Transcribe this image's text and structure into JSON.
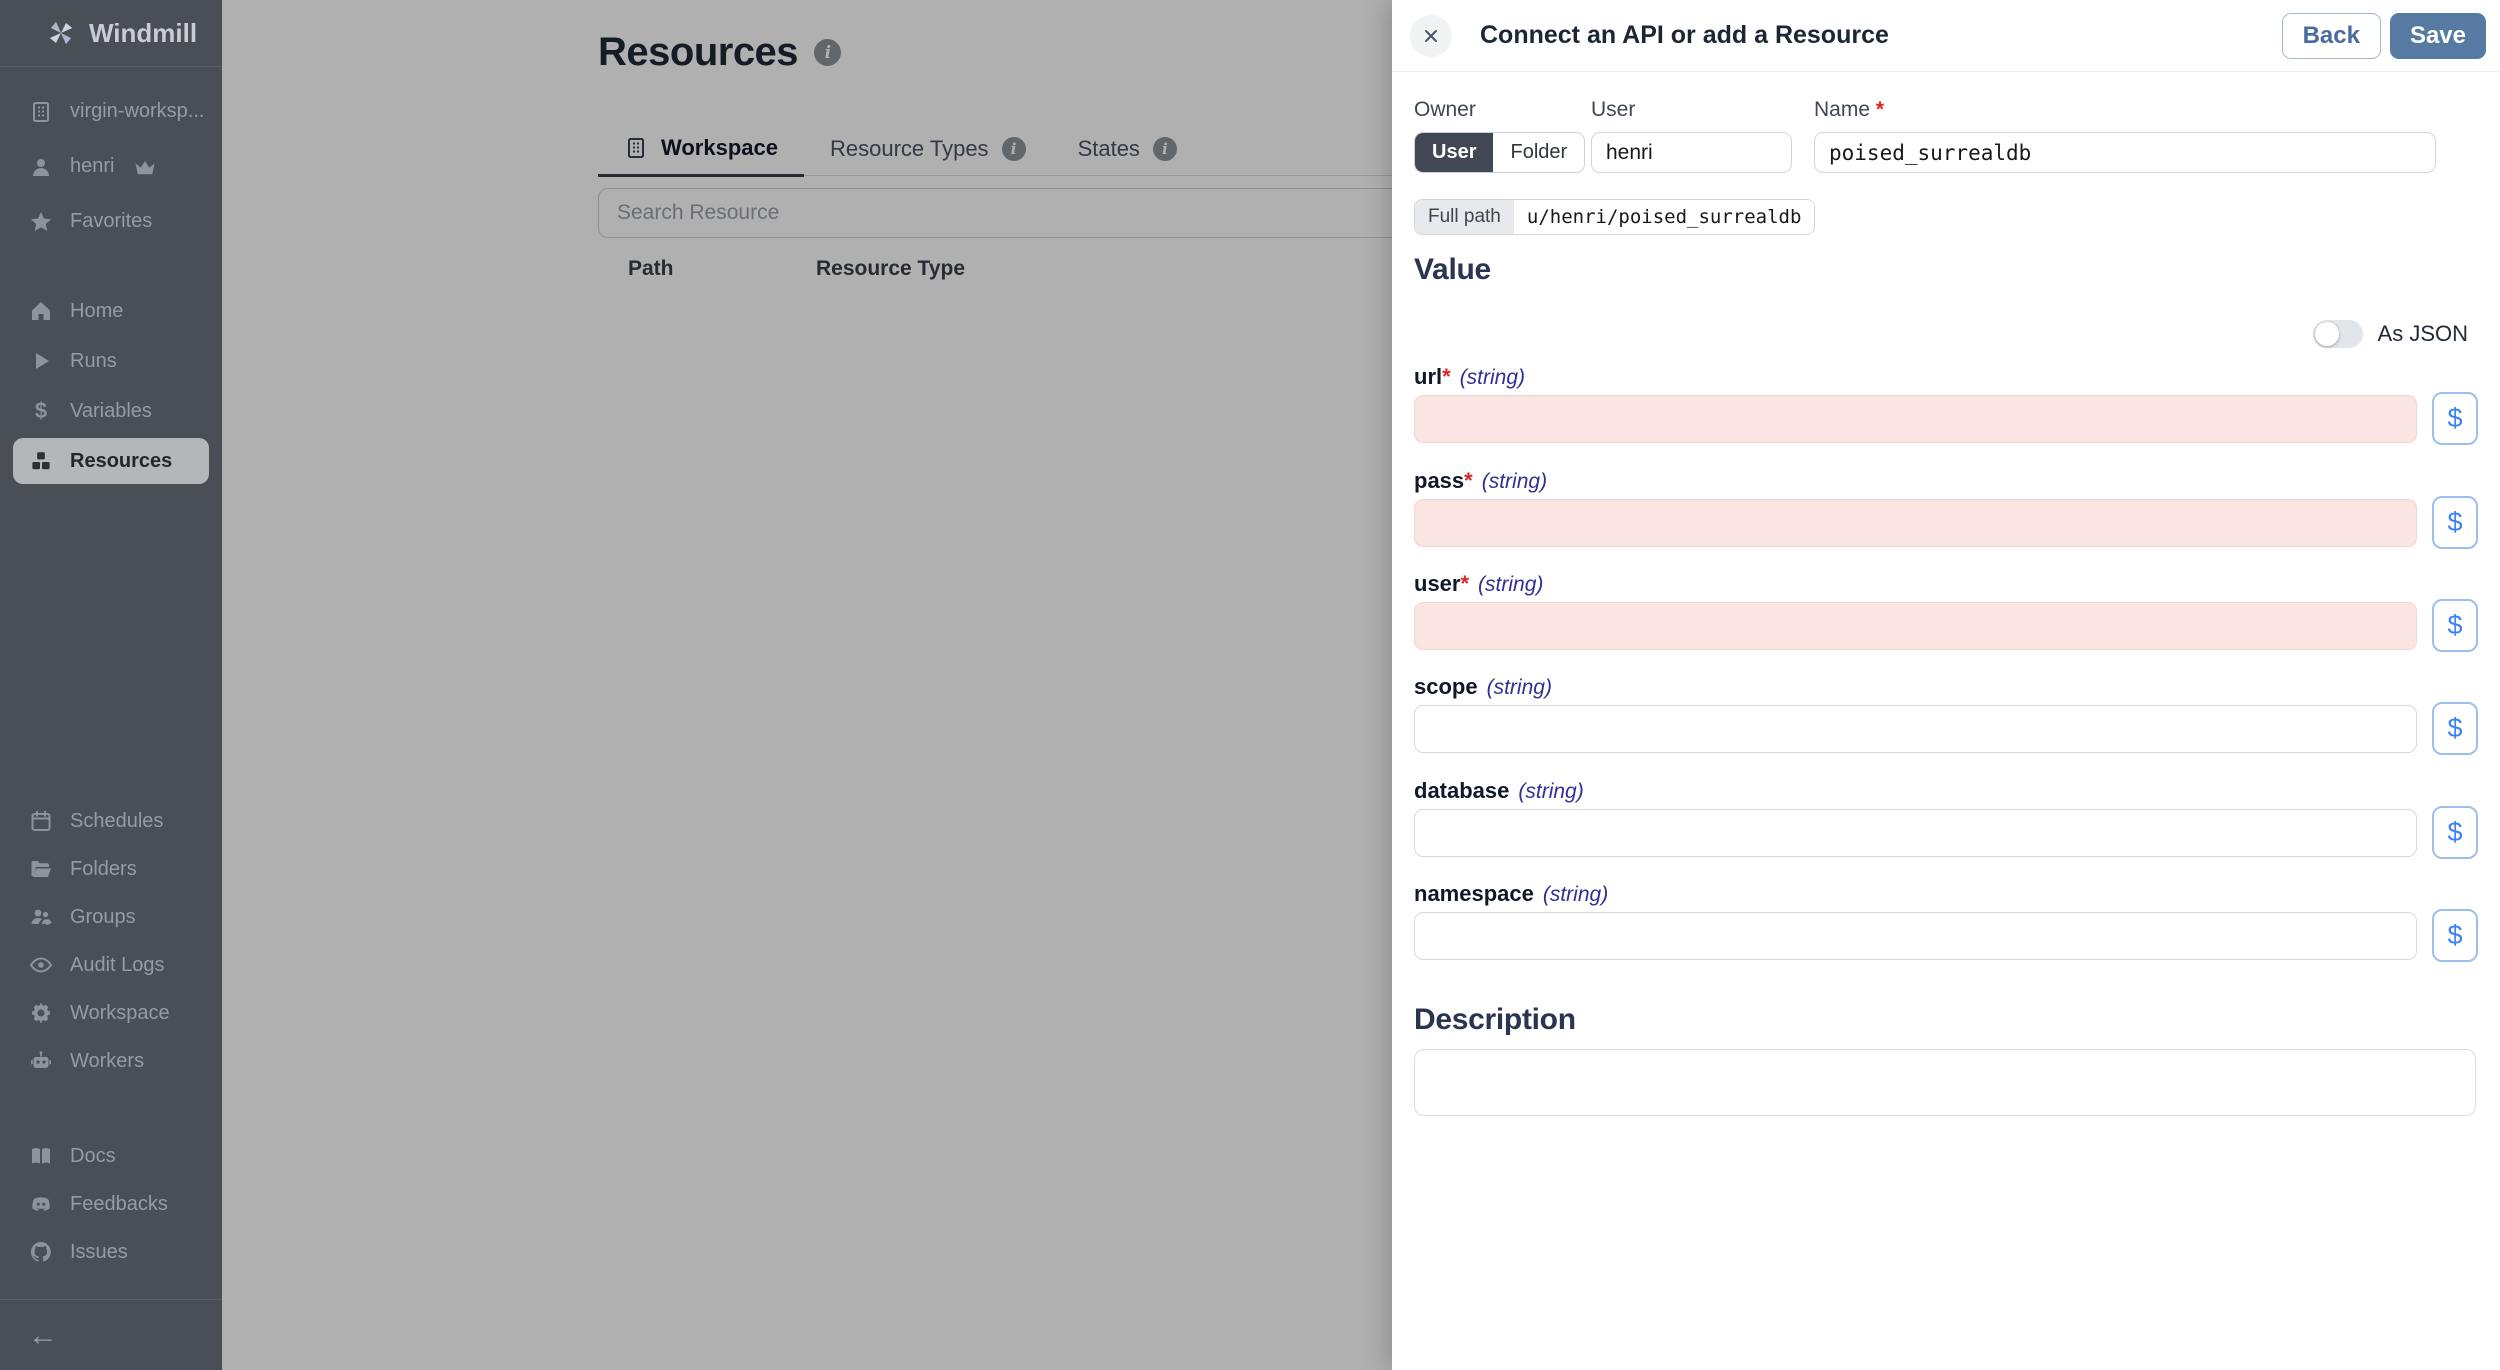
{
  "glyphs": {
    "dollar": "$",
    "info": "i",
    "collapse": "←"
  },
  "colors": {
    "sidebar_bg": "#4a4e55",
    "sidebar_text": "#979ba3",
    "selected_item_bg": "#b5b6b9",
    "accent_blue": "#3b82f6",
    "save_button": "#567aa1",
    "required_field_bg": "#fbe5e2",
    "backdrop": "rgba(0,0,0,0.31)",
    "heading": "#2b3450",
    "string_type": "#332f94",
    "required_mark": "#dc2626"
  },
  "sidebar": {
    "logo_text": "Windmill",
    "top_items": [
      {
        "label": "virgin-worksp...",
        "icon": "building-icon"
      },
      {
        "label": "henri",
        "icon": "user-icon"
      },
      {
        "label": "Favorites",
        "icon": "star-icon"
      }
    ],
    "nav_items": [
      {
        "label": "Home",
        "icon": "home-icon"
      },
      {
        "label": "Runs",
        "icon": "play-icon"
      },
      {
        "label": "Variables",
        "icon": "dollar-icon"
      },
      {
        "label": "Resources",
        "icon": "boxes-icon",
        "active": true
      }
    ],
    "admin_items": [
      {
        "label": "Schedules",
        "icon": "calendar-icon"
      },
      {
        "label": "Folders",
        "icon": "folder-icon"
      },
      {
        "label": "Groups",
        "icon": "users-icon"
      },
      {
        "label": "Audit Logs",
        "icon": "eye-icon"
      },
      {
        "label": "Workspace",
        "icon": "gear-icon"
      },
      {
        "label": "Workers",
        "icon": "robot-icon"
      }
    ],
    "footer_items": [
      {
        "label": "Docs",
        "icon": "book-icon"
      },
      {
        "label": "Feedbacks",
        "icon": "discord-icon"
      },
      {
        "label": "Issues",
        "icon": "github-icon"
      }
    ]
  },
  "main": {
    "title": "Resources",
    "tabs": [
      {
        "label": "Workspace",
        "active": true
      },
      {
        "label": "Resource Types",
        "active": false
      },
      {
        "label": "States",
        "active": false
      }
    ],
    "search_placeholder": "Search Resource",
    "table_headers": {
      "path": "Path",
      "resource_type": "Resource Type"
    }
  },
  "drawer": {
    "title": "Connect an API or add a Resource",
    "back_label": "Back",
    "save_label": "Save",
    "required_mark": "*",
    "owner": {
      "label": "Owner",
      "selected": "User",
      "other": "Folder"
    },
    "user_field": {
      "label": "User",
      "value": "henri"
    },
    "name_field": {
      "label": "Name",
      "value": "poised_surrealdb"
    },
    "full_path": {
      "label": "Full path",
      "value": "u/henri/poised_surrealdb"
    },
    "value_heading": "Value",
    "as_json_label": "As JSON",
    "fields": [
      {
        "name": "url",
        "type": "(string)",
        "required": true
      },
      {
        "name": "pass",
        "type": "(string)",
        "required": true
      },
      {
        "name": "user",
        "type": "(string)",
        "required": true
      },
      {
        "name": "scope",
        "type": "(string)",
        "required": false
      },
      {
        "name": "database",
        "type": "(string)",
        "required": false
      },
      {
        "name": "namespace",
        "type": "(string)",
        "required": false
      }
    ],
    "description_heading": "Description"
  }
}
